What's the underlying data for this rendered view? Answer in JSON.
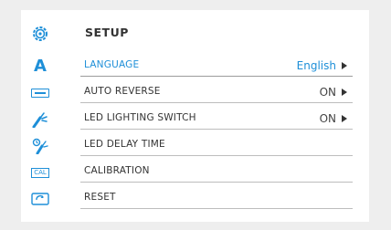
{
  "header": {
    "title": "SETUP",
    "icon": "gear-icon"
  },
  "colors": {
    "accent": "#1e8fd8",
    "text": "#333333",
    "divider": "#bdbdbd",
    "background": "#ffffff"
  },
  "menu": {
    "items": [
      {
        "icon": "language-icon",
        "icon_text": "A",
        "label": "LANGUAGE",
        "value": "English",
        "active": true
      },
      {
        "icon": "auto-reverse-icon",
        "label": "AUTO REVERSE",
        "value": "ON"
      },
      {
        "icon": "led-lighting-icon",
        "label": "LED LIGHTING SWITCH",
        "value": "ON"
      },
      {
        "icon": "led-delay-time-icon",
        "label": "LED DELAY TIME",
        "value": ""
      },
      {
        "icon": "calibration-icon",
        "icon_text": "CAL",
        "label": "CALIBRATION",
        "value": ""
      },
      {
        "icon": "reset-icon",
        "label": "RESET",
        "value": ""
      }
    ]
  }
}
